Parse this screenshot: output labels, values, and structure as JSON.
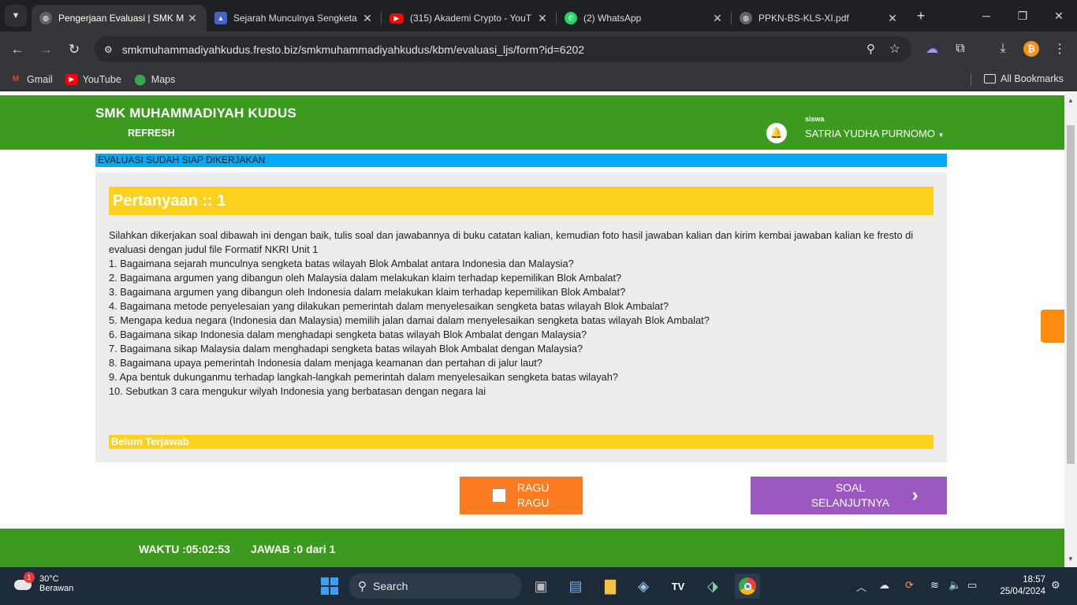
{
  "browser": {
    "tabs": [
      {
        "title": "Pengerjaan Evaluasi | SMK M",
        "active": true
      },
      {
        "title": "Sejarah Munculnya Sengketa",
        "active": false
      },
      {
        "title": "(315) Akademi Crypto - YouT",
        "active": false
      },
      {
        "title": "(2) WhatsApp",
        "active": false
      },
      {
        "title": "PPKN-BS-KLS-XI.pdf",
        "active": false
      }
    ],
    "url": "smkmuhammadiyahkudus.fresto.biz/smkmuhammadiyahkudus/kbm/evaluasi_ljs/form?id=6202",
    "bookmarks": [
      {
        "label": "Gmail"
      },
      {
        "label": "YouTube"
      },
      {
        "label": "Maps"
      }
    ],
    "all_bookmarks": "All Bookmarks"
  },
  "site": {
    "school_name": "SMK MUHAMMADIYAH KUDUS",
    "refresh": "REFRESH",
    "role": "siswa",
    "user_name": "SATRIA YUDHA PURNOMO",
    "status": "EVALUASI SUDAH SIAP DIKERJAKAN",
    "question_title": "Pertanyaan :: 1",
    "question_lines": [
      "Silahkan dikerjakan soal dibawah ini dengan baik, tulis soal dan jawabannya di buku catatan kalian, kemudian foto hasil jawaban kalian dan kirim kembai jawaban kalian ke fresto di",
      "evaluasi dengan judul file Formatif NKRI Unit 1",
      "1. Bagaimana sejarah munculnya sengketa batas wilayah Blok Ambalat antara Indonesia dan Malaysia?",
      "2. Bagaimana argumen yang dibangun oleh Malaysia dalam melakukan klaim terhadap kepemilikan Blok Ambalat?",
      "3. Bagaimana argumen yang dibangun oleh Indonesia dalam melakukan klaim terhadap kepemilikan Blok Ambalat?",
      "4. Bagaimana metode penyelesaian yang dilakukan pemerintah dalam menyelesaikan sengketa batas wilayah Blok Ambalat?",
      "5. Mengapa kedua negara (Indonesia dan Malaysia) memilih jalan damai dalam menyelesaikan sengketa batas wilayah Blok Ambalat?",
      "6. Bagaimana sikap Indonesia dalam menghadapi sengketa batas wilayah Blok Ambalat dengan Malaysia?",
      "7. Bagaimana sikap Malaysia dalam menghadapi sengketa batas wilayah Blok Ambalat dengan Malaysia?",
      "8. Bagaimana upaya pemerintah Indonesia dalam menjaga keamanan dan pertahan di jalur laut?",
      "9. Apa bentuk dukunganmu terhadap langkah-langkah pemerintah dalam menyelesaikan sengketa batas wilayah?",
      "10. Sebutkan 3 cara mengukur wilyah Indonesia yang berbatasan dengan negara lai"
    ],
    "answer_status": "Belum Terjawab",
    "ragu_label": "RAGU RAGU",
    "next_label": "SOAL SELANJUTNYA",
    "waktu": "WAKTU :05:02:53",
    "jawab": "JAWAB :0 dari 1"
  },
  "taskbar": {
    "temperature": "30°C",
    "weather": "Berawan",
    "weather_badge": "1",
    "search": "Search",
    "time": "18:57",
    "date": "25/04/2024"
  },
  "colors": {
    "site_green": "#3c9a1e",
    "status_blue": "#03a9f4",
    "question_yellow": "#fdd21f",
    "ragu_orange": "#fd7c21",
    "next_purple": "#9b59c0"
  }
}
